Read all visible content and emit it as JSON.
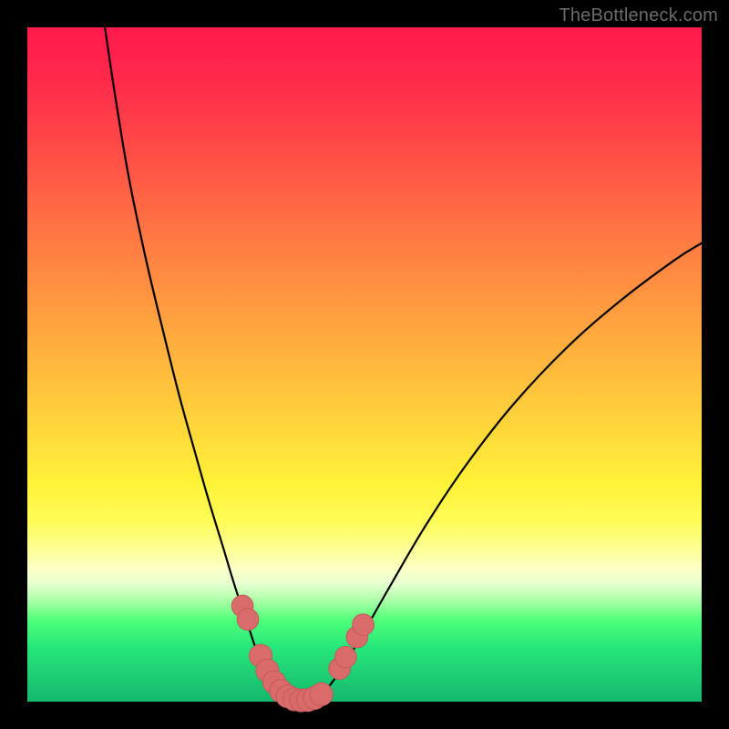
{
  "watermark": {
    "text": "TheBottleneck.com"
  },
  "colors": {
    "frame": "#000000",
    "curve": "#000000",
    "marker_fill": "#d96b6b",
    "marker_stroke": "#c25a5a"
  },
  "chart_data": {
    "type": "line",
    "title": "",
    "xlabel": "",
    "ylabel": "",
    "xlim": [
      0,
      100
    ],
    "ylim": [
      0,
      100
    ],
    "grid": false,
    "legend": false,
    "note": "Axes are percent extents of the plot area; y=0 at bottom. Values estimated from pixels.",
    "series": [
      {
        "name": "left-branch",
        "x": [
          11.5,
          13.0,
          15.0,
          17.5,
          20.0,
          22.5,
          25.0,
          27.0,
          29.0,
          30.5,
          31.8,
          33.0,
          34.0,
          35.0,
          36.0,
          37.0,
          37.8,
          38.5
        ],
        "y": [
          100.0,
          90.0,
          78.0,
          66.0,
          55.5,
          45.5,
          36.5,
          29.5,
          23.0,
          18.0,
          14.0,
          10.5,
          7.5,
          5.0,
          3.2,
          1.8,
          0.8,
          0.2
        ]
      },
      {
        "name": "right-branch",
        "x": [
          42.5,
          43.5,
          45.0,
          47.0,
          50.0,
          54.0,
          59.0,
          65.0,
          72.0,
          80.0,
          88.0,
          96.0,
          100.0
        ],
        "y": [
          0.2,
          1.0,
          2.6,
          5.5,
          10.5,
          17.5,
          26.0,
          35.0,
          44.0,
          52.5,
          59.5,
          65.5,
          68.0
        ]
      },
      {
        "name": "valley-floor",
        "x": [
          37.0,
          38.0,
          39.0,
          40.0,
          41.0,
          42.0,
          43.0,
          44.0
        ],
        "y": [
          0.6,
          0.25,
          0.1,
          0.05,
          0.05,
          0.1,
          0.25,
          0.6
        ]
      }
    ],
    "markers": [
      {
        "x": 31.9,
        "y": 14.2,
        "r": 1.6
      },
      {
        "x": 32.7,
        "y": 12.2,
        "r": 1.6
      },
      {
        "x": 34.6,
        "y": 6.8,
        "r": 1.7
      },
      {
        "x": 35.6,
        "y": 4.6,
        "r": 1.7
      },
      {
        "x": 36.6,
        "y": 2.9,
        "r": 1.7
      },
      {
        "x": 37.6,
        "y": 1.6,
        "r": 1.7
      },
      {
        "x": 38.6,
        "y": 0.8,
        "r": 1.7
      },
      {
        "x": 39.6,
        "y": 0.35,
        "r": 1.7
      },
      {
        "x": 40.6,
        "y": 0.2,
        "r": 1.7
      },
      {
        "x": 41.6,
        "y": 0.25,
        "r": 1.7
      },
      {
        "x": 42.6,
        "y": 0.55,
        "r": 1.7
      },
      {
        "x": 43.6,
        "y": 1.1,
        "r": 1.7
      },
      {
        "x": 46.3,
        "y": 4.9,
        "r": 1.6
      },
      {
        "x": 47.2,
        "y": 6.6,
        "r": 1.6
      },
      {
        "x": 48.9,
        "y": 9.6,
        "r": 1.6
      },
      {
        "x": 49.8,
        "y": 11.4,
        "r": 1.6
      }
    ]
  }
}
